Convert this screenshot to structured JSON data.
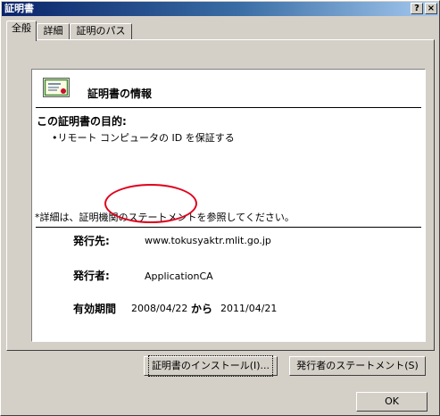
{
  "window": {
    "title": "証明書",
    "help_btn": "?",
    "close_btn": "×"
  },
  "tabs": [
    {
      "label": "全般",
      "active": true
    },
    {
      "label": "詳細",
      "active": false
    },
    {
      "label": "証明のパス",
      "active": false
    }
  ],
  "info": {
    "title": "証明書の情報",
    "purpose_title": "この証明書の目的:",
    "purpose_items": [
      "•リモート コンピュータの ID を保証する"
    ],
    "detail_note": "*詳細は、証明機関のステートメントを参照してください。",
    "issued_to_label": "発行先:",
    "issued_to_value": "www.tokusyaktr.mlit.go.jp",
    "issued_by_label": "発行者:",
    "issued_by_value": "ApplicationCA",
    "validity_label": "有効期間",
    "validity_from": "2008/04/22",
    "validity_to_word": "から",
    "validity_to": "2011/04/21"
  },
  "buttons": {
    "install": "証明書のインストール(I)...",
    "issuer_statement": "発行者のステートメント(S)",
    "ok": "OK"
  },
  "annotation": {
    "color": "#e0001b"
  }
}
